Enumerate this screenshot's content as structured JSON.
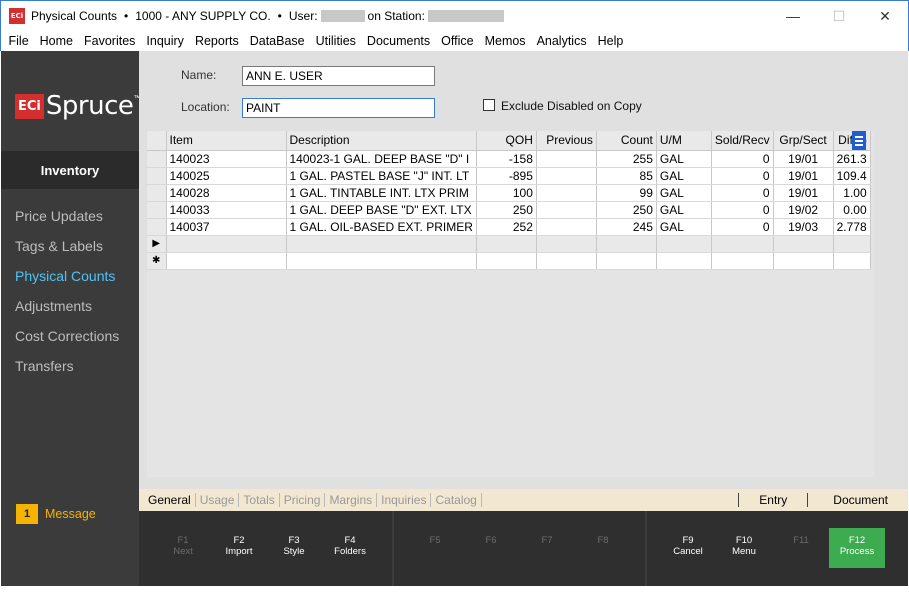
{
  "window": {
    "title_screen": "Physical Counts",
    "title_company": "1000 - ANY SUPPLY CO.",
    "user_label": "User:",
    "station_label": "on Station:",
    "bullet": "•",
    "app_icon_text": "ECi",
    "minimize": "—",
    "maximize": "☐",
    "close": "✕"
  },
  "menu": [
    "File",
    "Home",
    "Favorites",
    "Inquiry",
    "Reports",
    "DataBase",
    "Utilities",
    "Documents",
    "Office",
    "Memos",
    "Analytics",
    "Help"
  ],
  "logo": {
    "eci": "ECi",
    "name": "Spruce",
    "tm": "™"
  },
  "sidebar": {
    "section": "Inventory",
    "items": [
      {
        "label": "Price Updates",
        "active": false
      },
      {
        "label": "Tags & Labels",
        "active": false
      },
      {
        "label": "Physical Counts",
        "active": true
      },
      {
        "label": "Adjustments",
        "active": false
      },
      {
        "label": "Cost Corrections",
        "active": false
      },
      {
        "label": "Transfers",
        "active": false
      }
    ],
    "message_count": "1",
    "message_label": "Message"
  },
  "form": {
    "name_label": "Name:",
    "name_value": "ANN E. USER",
    "location_label": "Location:",
    "location_value": "PAINT",
    "exclude_label": "Exclude Disabled on Copy"
  },
  "grid": {
    "columns": [
      "Item",
      "Description",
      "QOH",
      "Previous",
      "Count",
      "U/M",
      "Sold/Recv",
      "Grp/Sect",
      "Diff%"
    ],
    "rows": [
      [
        "140023",
        "140023-1 GAL. DEEP BASE \"D\" I",
        "-158",
        "",
        "255",
        "GAL",
        "0",
        "19/01",
        "261.3"
      ],
      [
        "140025",
        "1 GAL. PASTEL BASE \"J\" INT. LT",
        "-895",
        "",
        "85",
        "GAL",
        "0",
        "19/01",
        "109.4"
      ],
      [
        "140028",
        "1 GAL. TINTABLE INT. LTX PRIM",
        "100",
        "",
        "99",
        "GAL",
        "0",
        "19/01",
        "1.00"
      ],
      [
        "140033",
        "1 GAL. DEEP BASE \"D\" EXT. LTX",
        "250",
        "",
        "250",
        "GAL",
        "0",
        "19/02",
        "0.00"
      ],
      [
        "140037",
        "1 GAL. OIL-BASED EXT. PRIMER",
        "252",
        "",
        "245",
        "GAL",
        "0",
        "19/03",
        "2.778"
      ]
    ],
    "current_marker": "▶",
    "new_marker": "✱"
  },
  "tabs": {
    "left": [
      "General",
      "Usage",
      "Totals",
      "Pricing",
      "Margins",
      "Inquiries",
      "Catalog"
    ],
    "right": [
      "Entry",
      "Document"
    ]
  },
  "fkeys": [
    {
      "key": "F1",
      "label": "Next",
      "enabled": false
    },
    {
      "key": "F2",
      "label": "Import",
      "enabled": true
    },
    {
      "key": "F3",
      "label": "Style",
      "enabled": true
    },
    {
      "key": "F4",
      "label": "Folders",
      "enabled": true
    },
    {
      "key": "F5",
      "label": "",
      "enabled": false
    },
    {
      "key": "F6",
      "label": "",
      "enabled": false
    },
    {
      "key": "F7",
      "label": "",
      "enabled": false
    },
    {
      "key": "F8",
      "label": "",
      "enabled": false
    },
    {
      "key": "F9",
      "label": "Cancel",
      "enabled": true
    },
    {
      "key": "F10",
      "label": "Menu",
      "enabled": true
    },
    {
      "key": "F11",
      "label": "",
      "enabled": false
    },
    {
      "key": "F12",
      "label": "Process",
      "enabled": true
    }
  ],
  "colors": {
    "accent": "#4fc3f7",
    "brand": "#d32f2f",
    "process": "#3dab4f",
    "message": "#f5b400"
  }
}
